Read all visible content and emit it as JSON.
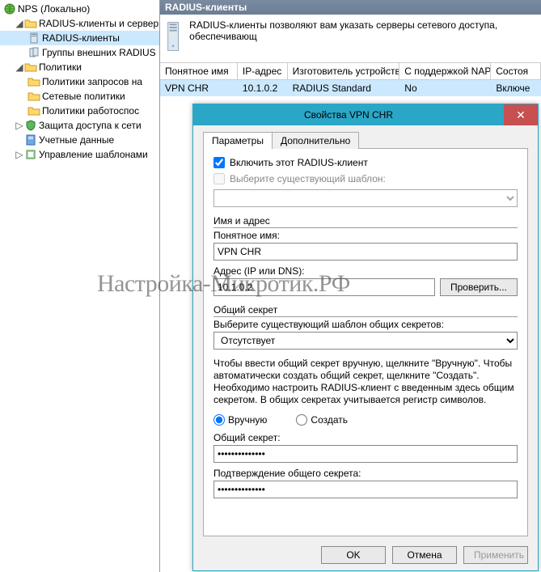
{
  "tree": {
    "root": "NPS (Локально)",
    "n1": "RADIUS-клиенты и сервер",
    "n1a": "RADIUS-клиенты",
    "n1b": "Группы внешних RADIUS",
    "n2": "Политики",
    "n2a": "Политики запросов на",
    "n2b": "Сетевые политики",
    "n2c": "Политики работоспос",
    "n3": "Защита доступа к сети",
    "n4": "Учетные данные",
    "n5": "Управление шаблонами"
  },
  "content": {
    "header": "RADIUS-клиенты",
    "info": "RADIUS-клиенты позволяют вам указать серверы сетевого доступа, обеспечивающ"
  },
  "grid": {
    "headers": {
      "c0": "Понятное имя",
      "c1": "IP-адрес",
      "c2": "Изготовитель устройства",
      "c3": "С поддержкой NAP",
      "c4": "Состоя"
    },
    "row": {
      "c0": "VPN CHR",
      "c1": "10.1.0.2",
      "c2": "RADIUS Standard",
      "c3": "No",
      "c4": "Включе"
    }
  },
  "dialog": {
    "title": "Свойства VPN CHR",
    "tab1": "Параметры",
    "tab2": "Дополнительно",
    "enable_label": "Включить этот RADIUS-клиент",
    "template_label": "Выберите существующий шаблон:",
    "section_name": "Имя и адрес",
    "friendly_label": "Понятное имя:",
    "friendly_value": "VPN CHR",
    "addr_label": "Адрес (IP или DNS):",
    "addr_value": "10.1.0.2",
    "verify_btn": "Проверить...",
    "section_secret": "Общий секрет",
    "secret_template_label": "Выберите существующий шаблон общих секретов:",
    "secret_template_value": "Отсутствует",
    "secret_help": "Чтобы ввести общий секрет вручную, щелкните \"Вручную\". Чтобы автоматически создать общий секрет, щелкните \"Создать\". Необходимо настроить RADIUS-клиент с введенным здесь общим секретом. В общих секретах учитывается регистр символов.",
    "radio_manual": "Вручную",
    "radio_create": "Создать",
    "secret_label": "Общий секрет:",
    "confirm_label": "Подтверждение общего секрета:",
    "secret_value": "••••••••••••••",
    "ok": "OK",
    "cancel": "Отмена",
    "apply": "Применить"
  },
  "watermark": "Настройка-Микротик.РФ"
}
